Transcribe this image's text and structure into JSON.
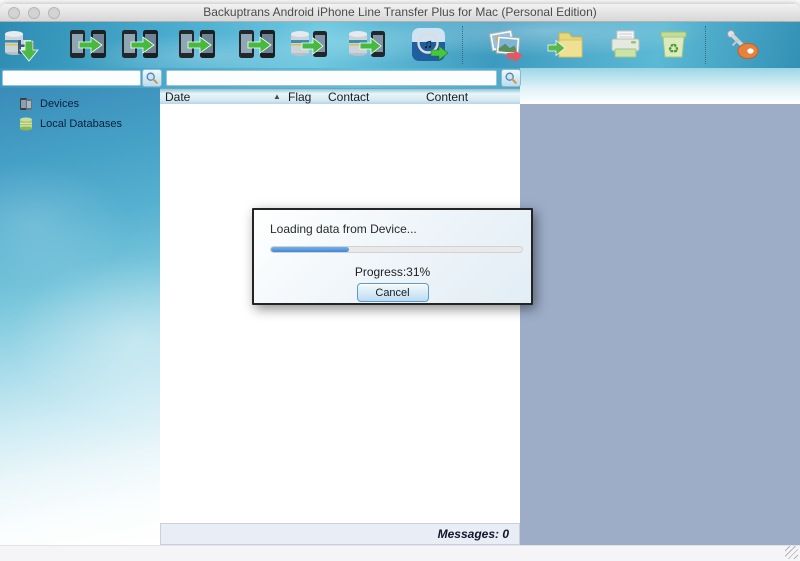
{
  "window": {
    "title": "Backuptrans Android iPhone Line Transfer Plus for Mac (Personal Edition)"
  },
  "toolbar": {
    "icons": [
      "backup-database",
      "android-to-iphone-transfer",
      "iphone-to-android-transfer",
      "android-to-android-transfer",
      "iphone-to-iphone-transfer",
      "database-to-android",
      "database-to-iphone",
      "export-to-itunes",
      "export-photos",
      "export-to-folder",
      "print",
      "recycle-bin",
      "register-key"
    ]
  },
  "search": {
    "left_value": "",
    "right_value": ""
  },
  "sidebar": {
    "items": [
      {
        "label": "Devices",
        "icon": "devices-icon"
      },
      {
        "label": "Local Databases",
        "icon": "database-icon"
      }
    ]
  },
  "table": {
    "columns": [
      "Date",
      "Flag",
      "Contact",
      "Content"
    ],
    "sort_indicator": "▲",
    "rows": []
  },
  "dialog": {
    "message": "Loading data from Device...",
    "progress_percent": 31,
    "progress_label": "Progress:31%",
    "cancel_label": "Cancel"
  },
  "status_bar": {
    "messages_label": "Messages: 0"
  },
  "colors": {
    "toolbar_aqua": "#3f9fc4",
    "right_panel": "#9dadc8",
    "progress_fill": "#4a8fd6",
    "header_gradient_bottom": "#b7d6e4",
    "status_bar_bg": "#e9edf6"
  }
}
